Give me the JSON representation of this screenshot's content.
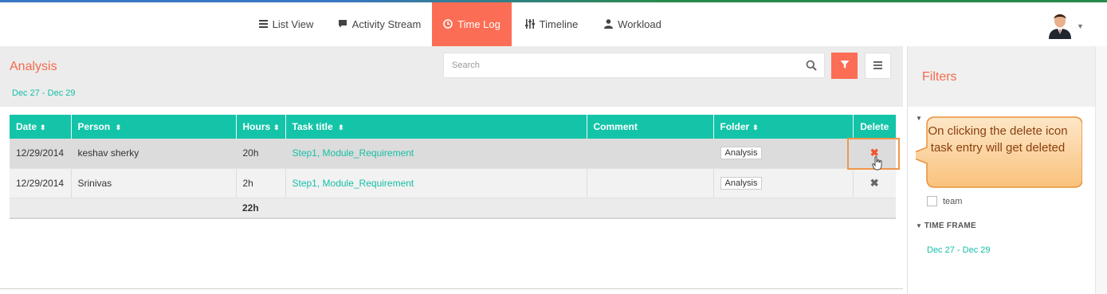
{
  "nav": {
    "tabs": [
      {
        "label": "List View",
        "icon": "list-icon"
      },
      {
        "label": "Activity Stream",
        "icon": "comment-icon"
      },
      {
        "label": "Time Log",
        "icon": "clock-icon"
      },
      {
        "label": "Timeline",
        "icon": "sliders-icon"
      },
      {
        "label": "Workload",
        "icon": "user-icon"
      }
    ],
    "active_tab": "Time Log"
  },
  "main": {
    "title": "Analysis",
    "date_from": "Dec 27",
    "date_sep": "-",
    "date_to": "Dec 29",
    "search_placeholder": "Search"
  },
  "table": {
    "headers": [
      "Date",
      "Person",
      "Hours",
      "Task title",
      "Comment",
      "Folder",
      "Delete"
    ],
    "rows": [
      {
        "date": "12/29/2014",
        "person": "keshav sherky",
        "hours": "20h",
        "task": "Step1, Module_Requirement",
        "comment": "",
        "folder": "Analysis"
      },
      {
        "date": "12/29/2014",
        "person": "Srinivas",
        "hours": "2h",
        "task": "Step1, Module_Requirement",
        "comment": "",
        "folder": "Analysis"
      }
    ],
    "total_hours": "22h"
  },
  "filters": {
    "title": "Filters",
    "team_label": "team",
    "time_frame_label": "TIME FRAME",
    "date_from": "Dec 27",
    "date_sep": "-",
    "date_to": "Dec 29"
  },
  "callout": {
    "text": "On clicking the delete icon task entry will get deleted"
  },
  "colors": {
    "accent_orange": "#fb6e55",
    "teal": "#14c4a8",
    "delete_red": "#f0532e"
  }
}
